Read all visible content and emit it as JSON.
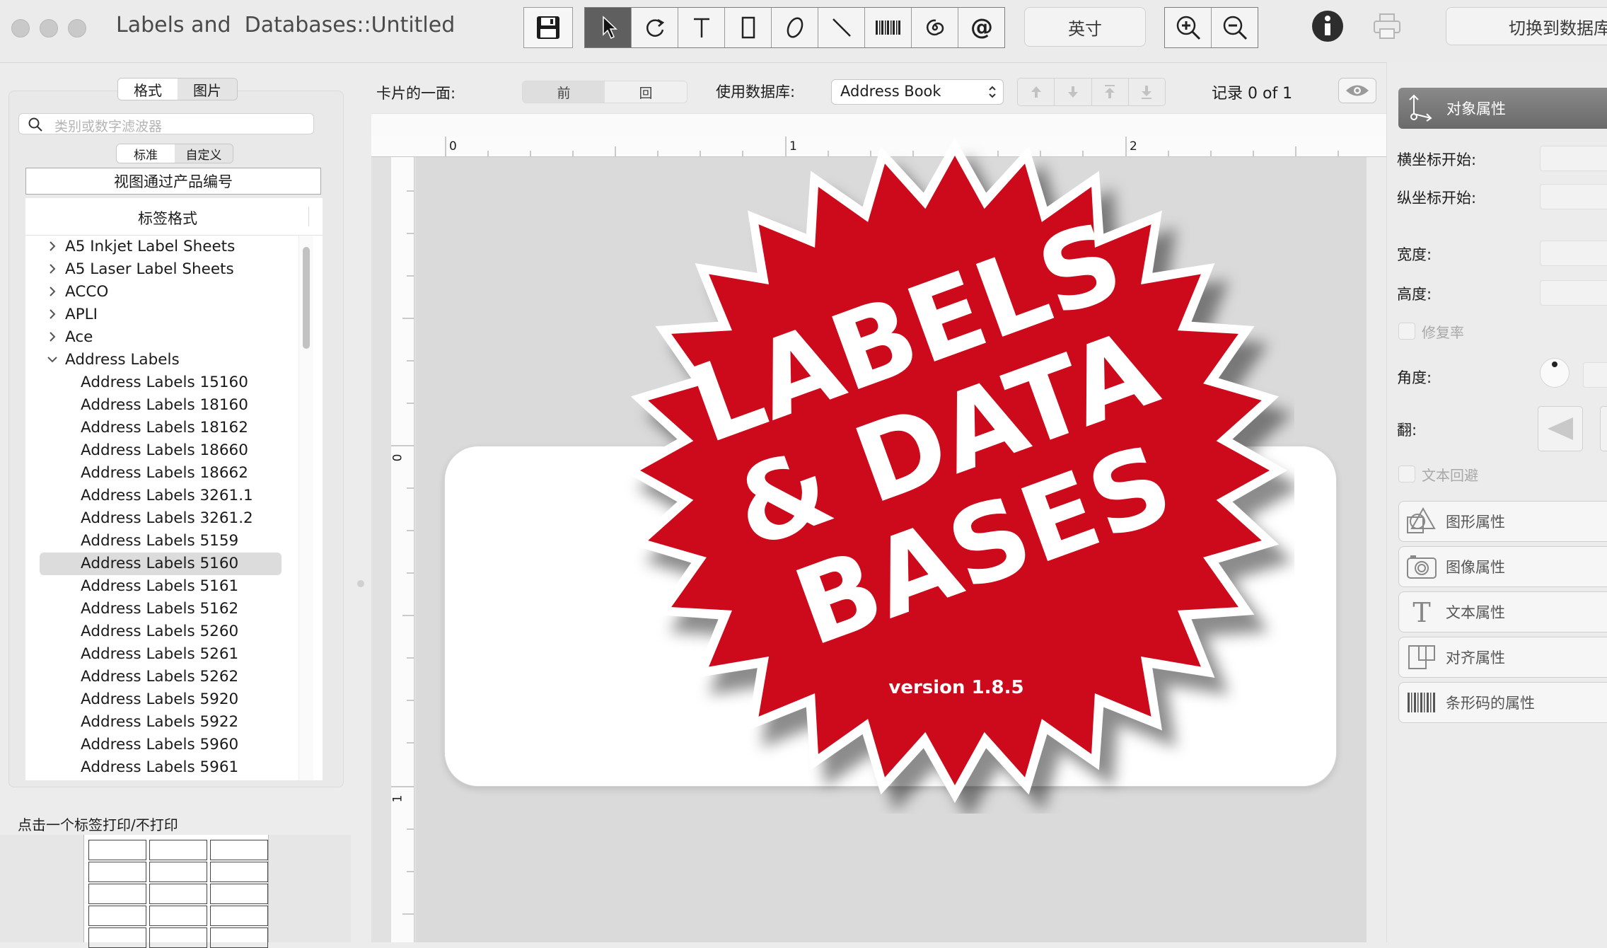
{
  "window": {
    "title": "Labels and  Databases::Untitled",
    "units_button": "英寸",
    "switch_db_button": "切换到数据库"
  },
  "sidebar": {
    "tabs": [
      "格式",
      "图片"
    ],
    "search_placeholder": "类别或数字滤波器",
    "subtabs": [
      "标准",
      "自定义"
    ],
    "view_by_button": "视图通过产品编号",
    "list_header": "标签格式",
    "items": [
      {
        "label": "A5 Inkjet Label Sheets",
        "level": 0,
        "expanded": false
      },
      {
        "label": "A5 Laser Label Sheets",
        "level": 0,
        "expanded": false
      },
      {
        "label": "ACCO",
        "level": 0,
        "expanded": false
      },
      {
        "label": "APLI",
        "level": 0,
        "expanded": false
      },
      {
        "label": "Ace",
        "level": 0,
        "expanded": false
      },
      {
        "label": "Address Labels",
        "level": 0,
        "expanded": true
      },
      {
        "label": "Address Labels 15160",
        "level": 1
      },
      {
        "label": "Address Labels 18160",
        "level": 1
      },
      {
        "label": "Address Labels 18162",
        "level": 1
      },
      {
        "label": "Address Labels 18660",
        "level": 1
      },
      {
        "label": "Address Labels 18662",
        "level": 1
      },
      {
        "label": "Address Labels 3261.1",
        "level": 1
      },
      {
        "label": "Address Labels 3261.2",
        "level": 1
      },
      {
        "label": "Address Labels 5159",
        "level": 1
      },
      {
        "label": "Address Labels 5160",
        "level": 1,
        "selected": true
      },
      {
        "label": "Address Labels 5161",
        "level": 1
      },
      {
        "label": "Address Labels 5162",
        "level": 1
      },
      {
        "label": "Address Labels 5260",
        "level": 1
      },
      {
        "label": "Address Labels 5261",
        "level": 1
      },
      {
        "label": "Address Labels 5262",
        "level": 1
      },
      {
        "label": "Address Labels 5920",
        "level": 1
      },
      {
        "label": "Address Labels 5922",
        "level": 1
      },
      {
        "label": "Address Labels 5960",
        "level": 1
      },
      {
        "label": "Address Labels 5961",
        "level": 1
      }
    ],
    "print_hint": "点击一个标签打印/不打印"
  },
  "toolbar2": {
    "card_side_label": "卡片的一面:",
    "front": "前",
    "back": "回",
    "db_label": "使用数据库:",
    "db_value": "Address Book",
    "record_text": "记录 0 of 1"
  },
  "rulers": {
    "h_ticks": [
      "0",
      "1",
      "2"
    ],
    "v_ticks": [
      "0",
      "1"
    ]
  },
  "splash": {
    "lines": [
      "LABELS",
      "& DATA",
      "BASES"
    ],
    "version": "version 1.8.5",
    "badge_color": "#cc0a1b"
  },
  "inspector": {
    "header": "对象属性",
    "x_label": "横坐标开始:",
    "y_label": "纵坐标开始:",
    "w_label": "宽度:",
    "h_label": "高度:",
    "fix_ratio": "修复率",
    "angle_label": "角度:",
    "flip_label": "翻:",
    "text_wrap": "文本回避",
    "sections": [
      "图形属性",
      "图像属性",
      "文本属性",
      "对齐属性",
      "条形码的属性"
    ]
  }
}
